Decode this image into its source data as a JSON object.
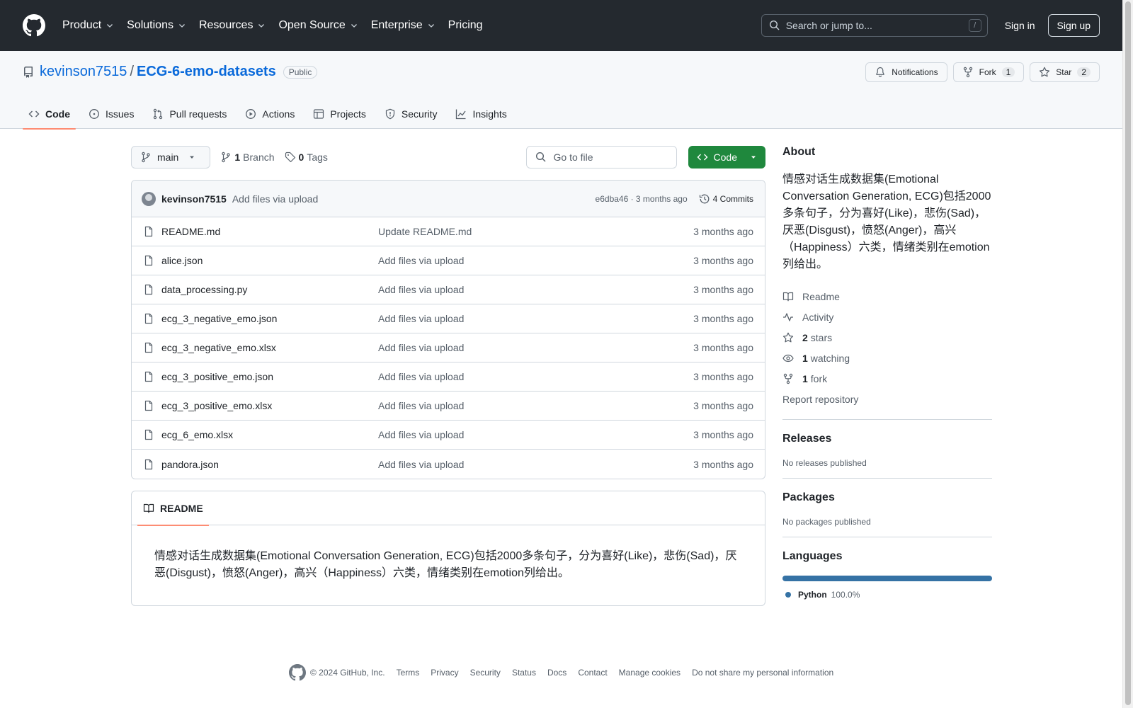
{
  "header": {
    "nav": [
      "Product",
      "Solutions",
      "Resources",
      "Open Source",
      "Enterprise",
      "Pricing"
    ],
    "search_placeholder": "Search or jump to...",
    "search_shortcut": "/",
    "sign_in": "Sign in",
    "sign_up": "Sign up"
  },
  "repo": {
    "owner": "kevinson7515",
    "separator": "/",
    "name": "ECG-6-emo-datasets",
    "visibility": "Public",
    "notifications_label": "Notifications",
    "fork_label": "Fork",
    "fork_count": "1",
    "star_label": "Star",
    "star_count": "2"
  },
  "tabs": [
    "Code",
    "Issues",
    "Pull requests",
    "Actions",
    "Projects",
    "Security",
    "Insights"
  ],
  "active_tab": "Code",
  "toolbar": {
    "branch": "main",
    "branch_count": "1",
    "branch_label": "Branch",
    "tag_count": "0",
    "tag_label": "Tags",
    "goto_placeholder": "Go to file",
    "code_button": "Code"
  },
  "commit": {
    "author": "kevinson7515",
    "message": "Add files via upload",
    "hash_time": "e6dba46 · 3 months ago",
    "commits_label": "4 Commits"
  },
  "files": [
    {
      "name": "README.md",
      "message": "Update README.md",
      "age": "3 months ago"
    },
    {
      "name": "alice.json",
      "message": "Add files via upload",
      "age": "3 months ago"
    },
    {
      "name": "data_processing.py",
      "message": "Add files via upload",
      "age": "3 months ago"
    },
    {
      "name": "ecg_3_negative_emo.json",
      "message": "Add files via upload",
      "age": "3 months ago"
    },
    {
      "name": "ecg_3_negative_emo.xlsx",
      "message": "Add files via upload",
      "age": "3 months ago"
    },
    {
      "name": "ecg_3_positive_emo.json",
      "message": "Add files via upload",
      "age": "3 months ago"
    },
    {
      "name": "ecg_3_positive_emo.xlsx",
      "message": "Add files via upload",
      "age": "3 months ago"
    },
    {
      "name": "ecg_6_emo.xlsx",
      "message": "Add files via upload",
      "age": "3 months ago"
    },
    {
      "name": "pandora.json",
      "message": "Add files via upload",
      "age": "3 months ago"
    }
  ],
  "readme": {
    "tab_label": "README",
    "body": "情感对话生成数据集(Emotional Conversation Generation, ECG)包括2000多条句子，分为喜好(Like)，悲伤(Sad)，厌恶(Disgust)，愤怒(Anger)，高兴（Happiness）六类，情绪类别在emotion列给出。"
  },
  "about": {
    "heading": "About",
    "description": "情感对话生成数据集(Emotional Conversation Generation, ECG)包括2000多条句子，分为喜好(Like)，悲伤(Sad)，厌恶(Disgust)，愤怒(Anger)，高兴（Happiness）六类，情绪类别在emotion列给出。",
    "readme": "Readme",
    "activity": "Activity",
    "stars_count": "2",
    "stars_label": "stars",
    "watching_count": "1",
    "watching_label": "watching",
    "fork_count": "1",
    "fork_label": "fork",
    "report": "Report repository"
  },
  "releases": {
    "heading": "Releases",
    "empty": "No releases published"
  },
  "packages": {
    "heading": "Packages",
    "empty": "No packages published"
  },
  "languages": {
    "heading": "Languages",
    "items": [
      {
        "name": "Python",
        "percent": "100.0%",
        "color": "#3572A5"
      }
    ]
  },
  "footer": {
    "copyright": "© 2024 GitHub, Inc.",
    "links": [
      "Terms",
      "Privacy",
      "Security",
      "Status",
      "Docs",
      "Contact",
      "Manage cookies",
      "Do not share my personal information"
    ]
  },
  "colors": {
    "header_bg": "#24292f",
    "link": "#0969da",
    "primary_button": "#1f883d",
    "tab_underline": "#fd8c73"
  }
}
